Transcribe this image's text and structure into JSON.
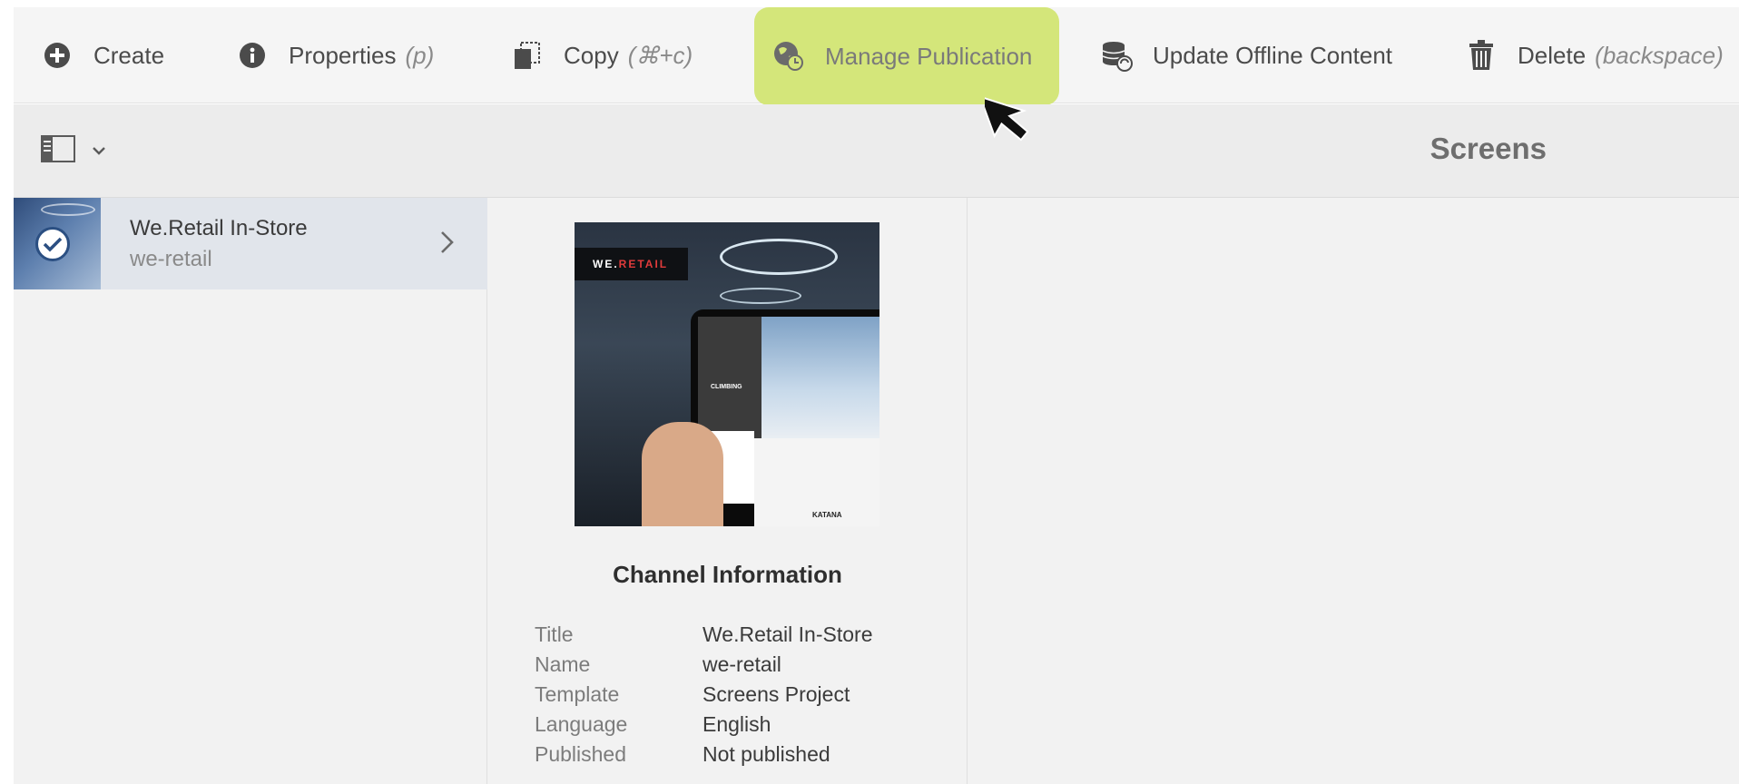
{
  "toolbar": {
    "create": "Create",
    "properties": "Properties",
    "properties_hint": "(p)",
    "copy": "Copy",
    "copy_hint": "(⌘+c)",
    "manage_publication": "Manage Publication",
    "update_offline": "Update Offline Content",
    "delete": "Delete",
    "delete_hint": "(backspace)"
  },
  "header": {
    "title": "Screens"
  },
  "list": {
    "items": [
      {
        "title": "We.Retail In-Store",
        "subtitle": "we-retail",
        "selected": true
      }
    ]
  },
  "preview": {
    "logo_we": "WE.",
    "logo_retail": "RETAIL",
    "tag": "CLIMBING",
    "product": "KATANA"
  },
  "details": {
    "heading": "Channel Information",
    "rows": [
      {
        "label": "Title",
        "value": "We.Retail In-Store"
      },
      {
        "label": "Name",
        "value": "we-retail"
      },
      {
        "label": "Template",
        "value": "Screens Project"
      },
      {
        "label": "Language",
        "value": "English"
      },
      {
        "label": "Published",
        "value": "Not published"
      }
    ]
  },
  "colors": {
    "highlight": "#d4e67a",
    "selected_row": "#e1e5eb"
  }
}
